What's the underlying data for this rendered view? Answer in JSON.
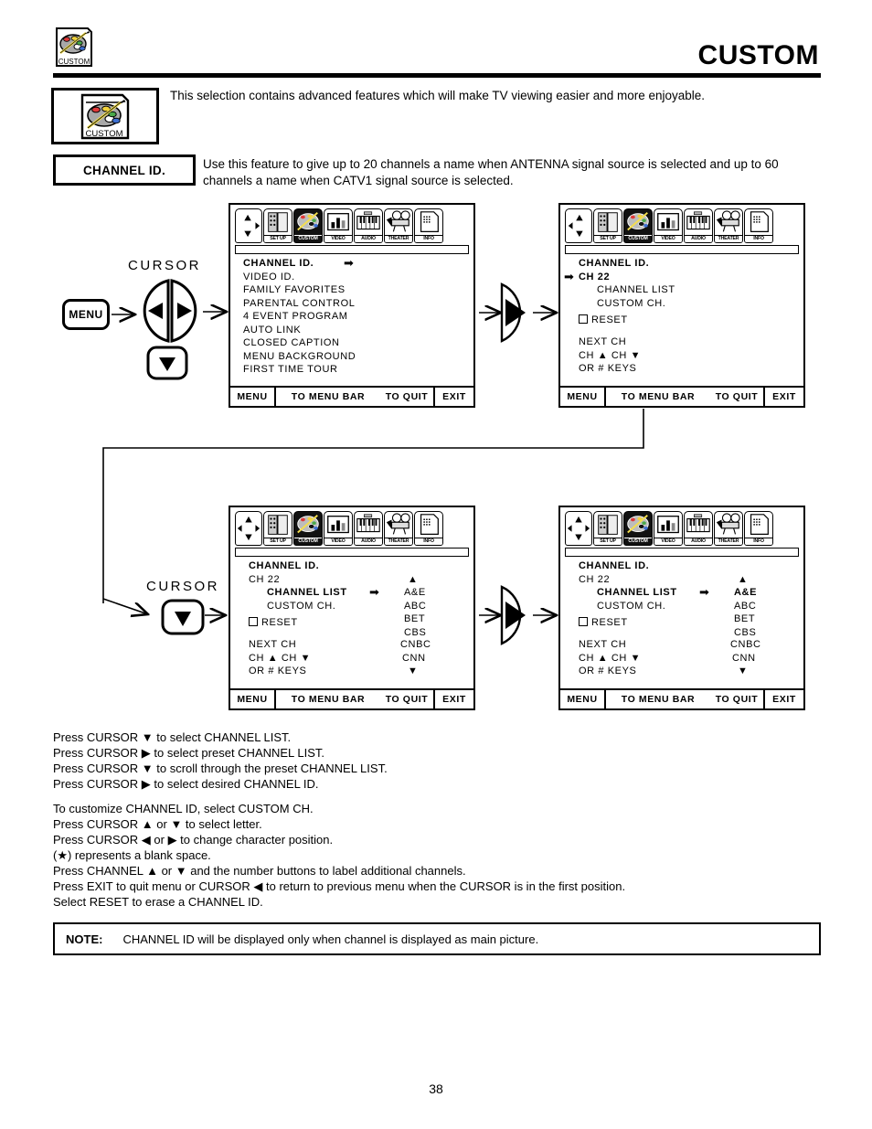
{
  "header": {
    "title": "CUSTOM",
    "icon": "custom-palette-icon",
    "icon_caption": "CUSTOM"
  },
  "intro": {
    "icon": "custom-palette-icon",
    "icon_caption": "CUSTOM",
    "text": "This selection contains advanced features which will make TV viewing easier and more enjoyable."
  },
  "feature": {
    "label": "CHANNEL ID.",
    "text": "Use this feature to give up to 20 channels a name when ANTENNA signal source is selected and up to 60 channels a name when CATV1 signal source is selected."
  },
  "menu_bar": {
    "items": [
      {
        "caption": "",
        "icon": "nav-arrows-icon",
        "active": false
      },
      {
        "caption": "SET UP",
        "icon": "setup-icon",
        "active": false
      },
      {
        "caption": "CUSTOM",
        "icon": "custom-palette-icon",
        "active": true
      },
      {
        "caption": "VIDEO",
        "icon": "video-icon",
        "active": false
      },
      {
        "caption": "AUDIO",
        "icon": "audio-keyboard-icon",
        "active": false
      },
      {
        "caption": "THEATER",
        "icon": "theater-projector-icon",
        "active": false
      },
      {
        "caption": "INFO",
        "icon": "info-document-icon",
        "active": false
      }
    ]
  },
  "status_bar": {
    "menu": "MENU",
    "to_menu_bar": "TO MENU BAR",
    "to_quit": "TO QUIT",
    "exit": "EXIT"
  },
  "screens": {
    "screen1": {
      "name": "custom-menu-list",
      "items": [
        {
          "label": "CHANNEL ID.",
          "bold": true,
          "arrow": true
        },
        {
          "label": "VIDEO ID.",
          "bold": false,
          "arrow": false
        },
        {
          "label": "FAMILY FAVORITES",
          "bold": false,
          "arrow": false
        },
        {
          "label": "PARENTAL CONTROL",
          "bold": false,
          "arrow": false
        },
        {
          "label": "4 EVENT PROGRAM",
          "bold": false,
          "arrow": false
        },
        {
          "label": "AUTO LINK",
          "bold": false,
          "arrow": false
        },
        {
          "label": "CLOSED CAPTION",
          "bold": false,
          "arrow": false
        },
        {
          "label": "MENU BACKGROUND",
          "bold": false,
          "arrow": false
        },
        {
          "label": "FIRST TIME TOUR",
          "bold": false,
          "arrow": false
        }
      ]
    },
    "screen2": {
      "name": "channel-id-detail",
      "title": "CHANNEL ID.",
      "selected_channel": "CH 22",
      "channel_list_label": "CHANNEL LIST",
      "custom_ch_label": "CUSTOM CH.",
      "reset_label": "RESET",
      "hint_line1": "NEXT CH",
      "hint_line2": "CH ▲ CH ▼",
      "hint_line3": "OR # KEYS"
    },
    "screen3": {
      "name": "channel-list-browse",
      "title": "CHANNEL ID.",
      "selected_channel": "CH 22",
      "channel_list_label": "CHANNEL LIST",
      "custom_ch_label": "CUSTOM CH.",
      "reset_label": "RESET",
      "hint_line1": "NEXT CH",
      "hint_line2": "CH ▲ CH ▼",
      "hint_line3": "OR # KEYS",
      "preset_list": [
        "A&E",
        "ABC",
        "BET",
        "CBS",
        "CNBC",
        "CNN"
      ],
      "scroll_up": "▲",
      "scroll_down": "▼",
      "highlight_preset": null
    },
    "screen4": {
      "name": "channel-list-selected",
      "title": "CHANNEL ID.",
      "selected_channel": "CH 22",
      "channel_list_label": "CHANNEL LIST",
      "custom_ch_label": "CUSTOM CH.",
      "reset_label": "RESET",
      "hint_line1": "NEXT CH",
      "hint_line2": "CH ▲ CH ▼",
      "hint_line3": "OR # KEYS",
      "preset_list": [
        "A&E",
        "ABC",
        "BET",
        "CBS",
        "CNBC",
        "CNN"
      ],
      "scroll_up": "▲",
      "scroll_down": "▼",
      "highlight_preset": "A&E"
    }
  },
  "controls": {
    "menu_button": "MENU",
    "cursor_label_1": "CURSOR",
    "cursor_label_2": "CURSOR"
  },
  "instructions": [
    "Press CURSOR  ▼ to select CHANNEL LIST.",
    "Press CURSOR ▶ to select preset CHANNEL LIST.",
    "Press CURSOR ▼ to scroll through the preset CHANNEL LIST.",
    "Press CURSOR ▶ to select desired CHANNEL ID.",
    "",
    "To customize CHANNEL ID, select CUSTOM CH.",
    "Press CURSOR ▲ or ▼ to select letter.",
    "Press CURSOR ◀ or ▶ to change character position.",
    "(★) represents a blank space.",
    "Press CHANNEL ▲ or ▼  and the number buttons to label additional channels.",
    "Press EXIT to quit menu or CURSOR ◀ to return to previous menu when the CURSOR is in the first position.",
    "Select RESET to erase a CHANNEL ID."
  ],
  "note": {
    "label": "NOTE:",
    "text": "CHANNEL ID will be displayed only when channel is displayed as main picture."
  },
  "page_number": "38",
  "colors": {
    "palette_red": "#e03a3a",
    "palette_yellow": "#f2d23c",
    "palette_green": "#4aa94a",
    "palette_blue": "#3d6fd1",
    "palette_gray": "#a8a8a8",
    "brush_yellow": "#f5df4d",
    "ink": "#000000",
    "paper": "#ffffff"
  }
}
